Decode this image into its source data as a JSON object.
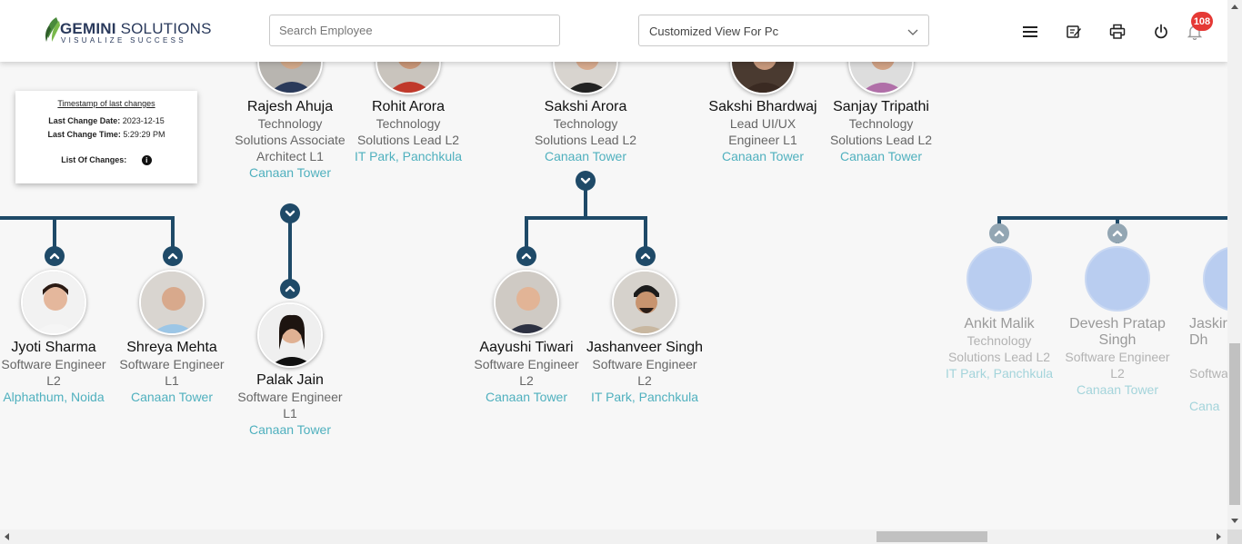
{
  "app": {
    "brand_bold": "GEMINI",
    "brand_light": "SOLUTIONS",
    "tagline": "VISUALIZE SUCCESS",
    "colors": {
      "accent": "#1f4a68",
      "location": "#4fb0be",
      "badge": "#e53935"
    }
  },
  "header": {
    "search_placeholder": "Search Employee",
    "view_selected": "Customized View For Pc",
    "notification_count": "108",
    "icons": [
      "menu-icon",
      "edit-note-icon",
      "printer-icon",
      "power-icon",
      "bell-icon"
    ]
  },
  "timestamp": {
    "title": "Timestamp of last changes",
    "date_label": "Last Change Date:",
    "date_value": "2023-12-15",
    "time_label": "Last Change Time:",
    "time_value": "5:29:29 PM",
    "changes_label": "List Of Changes:"
  },
  "people": {
    "rajesh": {
      "name": "Rajesh Ahuja",
      "designation": "Technology Solutions Associate Architect L1",
      "location": "Canaan Tower"
    },
    "rohit": {
      "name": "Rohit Arora",
      "designation": "Technology Solutions Lead L2",
      "location": "IT Park, Panchkula"
    },
    "sakshi_a": {
      "name": "Sakshi Arora",
      "designation": "Technology Solutions Lead L2",
      "location": "Canaan Tower"
    },
    "sakshi_b": {
      "name": "Sakshi Bhardwaj",
      "designation": "Lead UI/UX Engineer L1",
      "location": "Canaan Tower"
    },
    "sanjay": {
      "name": "Sanjay Tripathi",
      "designation": "Technology Solutions Lead L2",
      "location": "Canaan Tower"
    },
    "jyoti": {
      "name": "Jyoti Sharma",
      "designation": "Software Engineer L2",
      "location": "Alphathum, Noida"
    },
    "shreya": {
      "name": "Shreya Mehta",
      "designation": "Software Engineer L1",
      "location": "Canaan Tower"
    },
    "palak": {
      "name": "Palak Jain",
      "designation": "Software Engineer L1",
      "location": "Canaan Tower"
    },
    "aayushi": {
      "name": "Aayushi Tiwari",
      "designation": "Software Engineer L2",
      "location": "Canaan Tower"
    },
    "jashanveer": {
      "name": "Jashanveer Singh",
      "designation": "Software Engineer L2",
      "location": "IT Park, Panchkula"
    },
    "ankit": {
      "name": "Ankit Malik",
      "designation": "Technology Solutions Lead L2",
      "location": "IT Park, Panchkula"
    },
    "devesh": {
      "name": "Devesh Pratap Singh",
      "designation": "Software Engineer L2",
      "location": "Canaan Tower"
    },
    "jaski": {
      "name": "Jaskir Dh",
      "designation": "Softwar",
      "location": "Cana"
    }
  }
}
